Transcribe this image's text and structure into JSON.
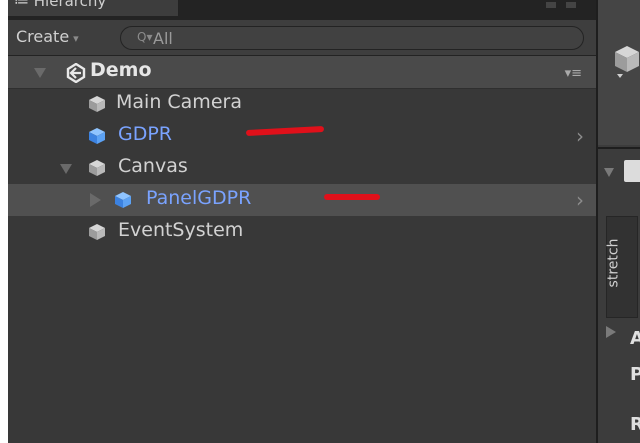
{
  "hierarchy": {
    "tab_title": "≔ Hierarchy",
    "create_label": "Create",
    "create_caret": "▾",
    "search_placeholder": "All",
    "search_glass": "Q▾",
    "scene": {
      "name": "Demo",
      "menu_glyph": "▾≡"
    },
    "items": [
      {
        "label": "Main Camera",
        "type": "gameobject"
      },
      {
        "label": "GDPR",
        "type": "prefab",
        "has_children_arrow": true
      },
      {
        "label": "Canvas",
        "type": "gameobject",
        "expanded": true
      },
      {
        "label": "PanelGDPR",
        "type": "prefab",
        "collapsed": true,
        "selected": true,
        "has_children_arrow": true
      },
      {
        "label": "EventSystem",
        "type": "gameobject"
      }
    ],
    "chevron_glyph": "›"
  },
  "inspector": {
    "stretch_label": "stretch",
    "letters": [
      "A",
      "P",
      "R"
    ]
  },
  "colors": {
    "panel_bg": "#383838",
    "prefab_text": "#7aa3ff",
    "normal_text": "#d2d2d2",
    "annotation_red": "#e0101a"
  },
  "icons": {
    "gameobject": "gray-cube-icon",
    "prefab": "blue-cube-icon",
    "scene": "unity-logo-icon"
  }
}
